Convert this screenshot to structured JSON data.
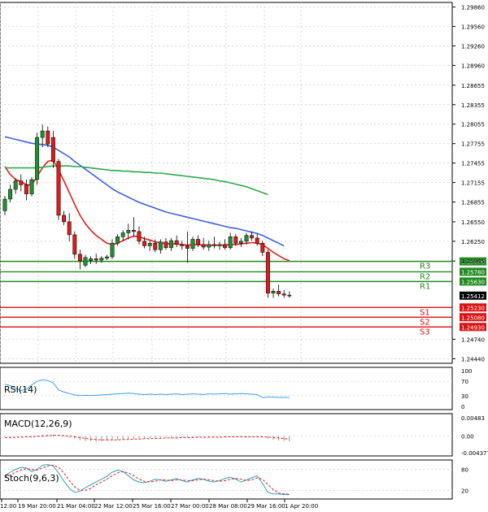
{
  "chart_data": {
    "type": "candlestick",
    "instrument_price_axis": {
      "ticks": [
        "1.29860",
        "1.29560",
        "1.29260",
        "1.28960",
        "1.28655",
        "1.28355",
        "1.28055",
        "1.27755",
        "1.27455",
        "1.27155",
        "1.26855",
        "1.26550",
        "1.26250",
        "1.25945",
        "1.24740",
        "1.24440"
      ],
      "tick_values": [
        1.2986,
        1.2956,
        1.2926,
        1.2896,
        1.28655,
        1.28355,
        1.28055,
        1.27755,
        1.27455,
        1.27155,
        1.26855,
        1.2655,
        1.2625,
        1.25945,
        1.2474,
        1.2444
      ],
      "range": [
        1.2437,
        1.2993
      ]
    },
    "current_price": {
      "label": "1.25412",
      "value": 1.25412
    },
    "levels": [
      {
        "name": "R3",
        "label": "1.25940",
        "value": 1.2594,
        "color": "#228b22"
      },
      {
        "name": "R2",
        "label": "1.25780",
        "value": 1.2578,
        "color": "#228b22"
      },
      {
        "name": "R1",
        "label": "1.25630",
        "value": 1.2563,
        "color": "#228b22"
      },
      {
        "name": "S1",
        "label": "1.25230",
        "value": 1.2523,
        "color": "#dd1111"
      },
      {
        "name": "S2",
        "label": "1.25080",
        "value": 1.2508,
        "color": "#dd1111"
      },
      {
        "name": "S3",
        "label": "1.24930",
        "value": 1.2493,
        "color": "#dd1111"
      }
    ],
    "x_labels": [
      "12:00",
      "19 Mar 20:00",
      "21 Mar 04:00",
      "22 Mar 12:00",
      "25 Mar 16:00",
      "27 Mar 00:00",
      "28 Mar 08:00",
      "29 Mar 16:00",
      "1 Apr 20:00"
    ],
    "candles": [
      {
        "o": 1.2672,
        "h": 1.2695,
        "l": 1.2665,
        "c": 1.269
      },
      {
        "o": 1.269,
        "h": 1.2712,
        "l": 1.2685,
        "c": 1.2705
      },
      {
        "o": 1.2705,
        "h": 1.2722,
        "l": 1.2698,
        "c": 1.2718
      },
      {
        "o": 1.2718,
        "h": 1.2728,
        "l": 1.2702,
        "c": 1.2712
      },
      {
        "o": 1.2712,
        "h": 1.272,
        "l": 1.2688,
        "c": 1.2698
      },
      {
        "o": 1.2698,
        "h": 1.2724,
        "l": 1.2694,
        "c": 1.272
      },
      {
        "o": 1.272,
        "h": 1.2792,
        "l": 1.2712,
        "c": 1.2785
      },
      {
        "o": 1.2785,
        "h": 1.2805,
        "l": 1.277,
        "c": 1.2795
      },
      {
        "o": 1.2795,
        "h": 1.2802,
        "l": 1.277,
        "c": 1.2775
      },
      {
        "o": 1.2785,
        "h": 1.2795,
        "l": 1.2738,
        "c": 1.2748
      },
      {
        "o": 1.2748,
        "h": 1.2752,
        "l": 1.2658,
        "c": 1.2665
      },
      {
        "o": 1.2665,
        "h": 1.2672,
        "l": 1.265,
        "c": 1.2655
      },
      {
        "o": 1.2655,
        "h": 1.2668,
        "l": 1.2625,
        "c": 1.2635
      },
      {
        "o": 1.2635,
        "h": 1.264,
        "l": 1.2598,
        "c": 1.2605
      },
      {
        "o": 1.2605,
        "h": 1.2612,
        "l": 1.2582,
        "c": 1.2595
      },
      {
        "o": 1.2588,
        "h": 1.2604,
        "l": 1.2585,
        "c": 1.26
      },
      {
        "o": 1.2595,
        "h": 1.2602,
        "l": 1.259,
        "c": 1.2598
      },
      {
        "o": 1.2598,
        "h": 1.2606,
        "l": 1.259,
        "c": 1.2596
      },
      {
        "o": 1.2596,
        "h": 1.2602,
        "l": 1.2592,
        "c": 1.2599
      },
      {
        "o": 1.2599,
        "h": 1.2604,
        "l": 1.2596,
        "c": 1.2601
      },
      {
        "o": 1.2601,
        "h": 1.2628,
        "l": 1.2598,
        "c": 1.2622
      },
      {
        "o": 1.2622,
        "h": 1.2636,
        "l": 1.2618,
        "c": 1.2632
      },
      {
        "o": 1.2632,
        "h": 1.2642,
        "l": 1.2626,
        "c": 1.2638
      },
      {
        "o": 1.2638,
        "h": 1.2652,
        "l": 1.2628,
        "c": 1.2642
      },
      {
        "o": 1.2642,
        "h": 1.2662,
        "l": 1.2632,
        "c": 1.264
      },
      {
        "o": 1.264,
        "h": 1.2648,
        "l": 1.262,
        "c": 1.2625
      },
      {
        "o": 1.2625,
        "h": 1.2632,
        "l": 1.2614,
        "c": 1.2618
      },
      {
        "o": 1.2618,
        "h": 1.2626,
        "l": 1.261,
        "c": 1.2622
      },
      {
        "o": 1.2622,
        "h": 1.2628,
        "l": 1.2608,
        "c": 1.2612
      },
      {
        "o": 1.2612,
        "h": 1.2628,
        "l": 1.2606,
        "c": 1.2624
      },
      {
        "o": 1.2624,
        "h": 1.263,
        "l": 1.2612,
        "c": 1.2615
      },
      {
        "o": 1.2615,
        "h": 1.263,
        "l": 1.261,
        "c": 1.2626
      },
      {
        "o": 1.2626,
        "h": 1.2634,
        "l": 1.2616,
        "c": 1.262
      },
      {
        "o": 1.262,
        "h": 1.2626,
        "l": 1.2612,
        "c": 1.2618
      },
      {
        "o": 1.2618,
        "h": 1.264,
        "l": 1.2592,
        "c": 1.2614
      },
      {
        "o": 1.2614,
        "h": 1.2632,
        "l": 1.261,
        "c": 1.2628
      },
      {
        "o": 1.2628,
        "h": 1.2634,
        "l": 1.2616,
        "c": 1.262
      },
      {
        "o": 1.262,
        "h": 1.263,
        "l": 1.2612,
        "c": 1.2616
      },
      {
        "o": 1.2616,
        "h": 1.2626,
        "l": 1.261,
        "c": 1.262
      },
      {
        "o": 1.262,
        "h": 1.2632,
        "l": 1.2614,
        "c": 1.2618
      },
      {
        "o": 1.2618,
        "h": 1.2624,
        "l": 1.2612,
        "c": 1.262
      },
      {
        "o": 1.262,
        "h": 1.2628,
        "l": 1.2612,
        "c": 1.2615
      },
      {
        "o": 1.2615,
        "h": 1.2638,
        "l": 1.2612,
        "c": 1.2632
      },
      {
        "o": 1.2632,
        "h": 1.2636,
        "l": 1.2618,
        "c": 1.2622
      },
      {
        "o": 1.2622,
        "h": 1.263,
        "l": 1.2616,
        "c": 1.2625
      },
      {
        "o": 1.2625,
        "h": 1.2638,
        "l": 1.262,
        "c": 1.2634
      },
      {
        "o": 1.2634,
        "h": 1.264,
        "l": 1.2626,
        "c": 1.263
      },
      {
        "o": 1.263,
        "h": 1.2636,
        "l": 1.2618,
        "c": 1.2622
      },
      {
        "o": 1.2622,
        "h": 1.2626,
        "l": 1.2602,
        "c": 1.2608
      },
      {
        "o": 1.2608,
        "h": 1.2612,
        "l": 1.2538,
        "c": 1.2545
      },
      {
        "o": 1.2545,
        "h": 1.2552,
        "l": 1.2538,
        "c": 1.2548
      },
      {
        "o": 1.2548,
        "h": 1.2558,
        "l": 1.254,
        "c": 1.2544
      },
      {
        "o": 1.2544,
        "h": 1.255,
        "l": 1.2538,
        "c": 1.2542
      },
      {
        "o": 1.2542,
        "h": 1.2548,
        "l": 1.2538,
        "c": 1.2541
      }
    ],
    "moving_averages": [
      {
        "color": "#e81e1e",
        "values": [
          1.274,
          1.2728,
          1.272,
          1.2717,
          1.2712,
          1.2712,
          1.2725,
          1.2738,
          1.2748,
          1.275,
          1.2735,
          1.2718,
          1.27,
          1.2682,
          1.2665,
          1.2652,
          1.2642,
          1.2634,
          1.2628,
          1.2622,
          1.262,
          1.2622,
          1.2626,
          1.263,
          1.2633,
          1.2632,
          1.2629,
          1.2627,
          1.2624,
          1.2623,
          1.2621,
          1.2621,
          1.2621,
          1.262,
          1.2619,
          1.262,
          1.262,
          1.2619,
          1.2619,
          1.2619,
          1.2619,
          1.2619,
          1.262,
          1.262,
          1.2621,
          1.2622,
          1.2623,
          1.2622,
          1.262,
          1.2614,
          1.2608,
          1.2603,
          1.2598,
          1.2595
        ]
      },
      {
        "color": "#3f60e0",
        "values": [
          1.2786,
          1.2784,
          1.2782,
          1.278,
          1.2778,
          1.2776,
          1.2775,
          1.2774,
          1.2773,
          1.277,
          1.2765,
          1.276,
          1.2755,
          1.2748,
          1.2742,
          1.2736,
          1.273,
          1.2724,
          1.2718,
          1.2712,
          1.2706,
          1.2701,
          1.2697,
          1.2693,
          1.2689,
          1.2685,
          1.2682,
          1.2679,
          1.2676,
          1.2673,
          1.267,
          1.2668,
          1.2666,
          1.2664,
          1.2662,
          1.266,
          1.2658,
          1.2656,
          1.2654,
          1.2652,
          1.265,
          1.2648,
          1.2646,
          1.2645,
          1.2643,
          1.2641,
          1.2639,
          1.2637,
          1.2634,
          1.263,
          1.2626,
          1.2622,
          1.2618
        ]
      },
      {
        "color": "#2ea84a",
        "values": [
          1.2738,
          1.2738,
          1.2738,
          1.2738,
          1.2738,
          1.2738,
          1.2738,
          1.2739,
          1.274,
          1.2741,
          1.2741,
          1.2741,
          1.2741,
          1.274,
          1.274,
          1.2739,
          1.2738,
          1.2737,
          1.2736,
          1.2735,
          1.2734,
          1.2734,
          1.2733,
          1.2733,
          1.2732,
          1.2732,
          1.2731,
          1.2731,
          1.273,
          1.273,
          1.2729,
          1.2728,
          1.2727,
          1.2726,
          1.2725,
          1.2724,
          1.2723,
          1.2722,
          1.2721,
          1.272,
          1.2718,
          1.2717,
          1.2715,
          1.2713,
          1.2711,
          1.2709,
          1.2706,
          1.2703,
          1.27,
          1.2697
        ]
      }
    ],
    "rsi": {
      "title": "RSI(14)",
      "ticks": [
        "100",
        "70",
        "30",
        "0"
      ],
      "tick_values": [
        100,
        70,
        30,
        0
      ],
      "values": [
        62,
        58,
        50,
        44,
        48,
        60,
        70,
        74,
        72,
        66,
        46,
        40,
        36,
        32,
        30,
        31,
        30,
        31,
        32,
        33,
        34,
        35,
        36,
        37,
        36,
        34,
        33,
        34,
        33,
        34,
        33,
        34,
        35,
        33,
        34,
        35,
        34,
        33,
        35,
        34,
        35,
        36,
        34,
        35,
        36,
        35,
        34,
        33,
        24,
        26,
        26,
        25,
        25,
        25
      ]
    },
    "macd": {
      "title": "MACD(12,26,9)",
      "ticks": [
        "0.00483",
        "0.00",
        "-0.004377"
      ],
      "tick_values": [
        0.00483,
        0,
        -0.004377
      ],
      "hist": [
        -0.0002,
        -0.0002,
        -0.0001,
        -0.0001,
        -0.0001,
        -0.0001,
        0.0002,
        0.0004,
        0.0005,
        0.0004,
        0.0002,
        -0.0001,
        -0.0005,
        -0.0008,
        -0.0011,
        -0.0013,
        -0.0014,
        -0.0015,
        -0.0014,
        -0.0013,
        -0.0012,
        -0.001,
        -0.0009,
        -0.0008,
        -0.0007,
        -0.0006,
        -0.0006,
        -0.0005,
        -0.0005,
        -0.0004,
        -0.0004,
        -0.0004,
        -0.0003,
        -0.0003,
        -0.0003,
        -0.0003,
        -0.0003,
        -0.0002,
        -0.0002,
        -0.0002,
        -0.0002,
        -0.0002,
        -0.0002,
        -0.0001,
        -0.0001,
        -0.0001,
        -0.0001,
        -0.0002,
        -0.0004,
        -0.0007,
        -0.001,
        -0.0012,
        -0.0013,
        -0.0014
      ],
      "signal": [
        -0.0004,
        -0.0004,
        -0.0003,
        -0.0003,
        -0.0002,
        -0.0002,
        -0.0001,
        0.0,
        0.0001,
        0.0002,
        0.0002,
        0.0001,
        0.0,
        -0.0002,
        -0.0004,
        -0.0006,
        -0.0008,
        -0.0009,
        -0.001,
        -0.001,
        -0.001,
        -0.001,
        -0.0009,
        -0.0009,
        -0.0008,
        -0.0008,
        -0.0007,
        -0.0007,
        -0.0006,
        -0.0006,
        -0.0005,
        -0.0005,
        -0.0005,
        -0.0004,
        -0.0004,
        -0.0004,
        -0.0003,
        -0.0003,
        -0.0003,
        -0.0003,
        -0.0003,
        -0.0002,
        -0.0002,
        -0.0002,
        -0.0002,
        -0.0002,
        -0.0002,
        -0.0002,
        -0.0002,
        -0.0003,
        -0.0004,
        -0.0005,
        -0.0007,
        -0.0008
      ]
    },
    "stoch": {
      "title": "Stoch(9,6,3)",
      "ticks": [
        "80",
        "20"
      ],
      "tick_values": [
        80,
        20
      ],
      "k": [
        62,
        72,
        80,
        86,
        84,
        74,
        80,
        92,
        94,
        90,
        70,
        46,
        26,
        14,
        18,
        28,
        36,
        44,
        52,
        60,
        72,
        78,
        74,
        62,
        50,
        44,
        42,
        46,
        52,
        50,
        46,
        50,
        54,
        48,
        44,
        50,
        54,
        52,
        46,
        44,
        48,
        54,
        58,
        52,
        44,
        50,
        56,
        62,
        40,
        14,
        10,
        10,
        8,
        8
      ],
      "d": [
        58,
        64,
        72,
        78,
        82,
        80,
        78,
        84,
        90,
        92,
        86,
        70,
        48,
        30,
        20,
        20,
        26,
        36,
        44,
        52,
        62,
        70,
        74,
        70,
        62,
        52,
        46,
        44,
        46,
        50,
        50,
        48,
        50,
        50,
        48,
        48,
        50,
        52,
        50,
        48,
        46,
        48,
        52,
        54,
        52,
        48,
        50,
        56,
        52,
        36,
        22,
        12,
        10,
        9
      ]
    }
  }
}
